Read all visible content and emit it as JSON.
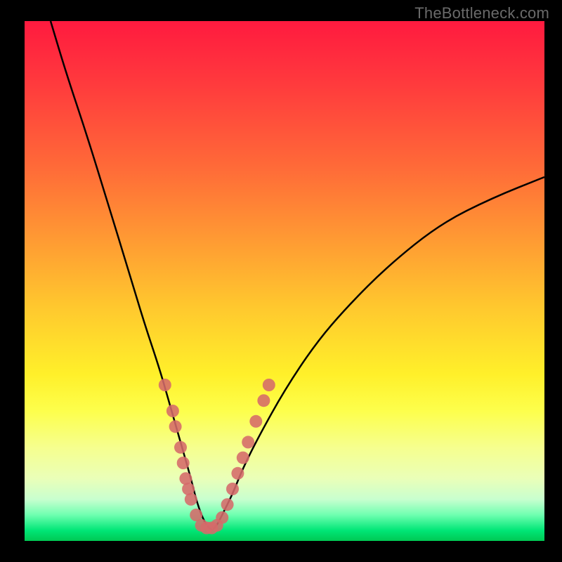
{
  "attribution": "TheBottleneck.com",
  "colors": {
    "frame": "#000000",
    "curve_stroke": "#000000",
    "marker_fill": "#d56a6a",
    "gradient_top": "#ff1a3f",
    "gradient_bottom": "#00c853"
  },
  "chart_data": {
    "type": "line",
    "title": "",
    "xlabel": "",
    "ylabel": "",
    "xlim": [
      0,
      100
    ],
    "ylim": [
      0,
      100
    ],
    "note": "Axes are not labeled in the image; values estimated from pixel positions. y=0 corresponds to the bottom (green) edge, y=100 to the top (red) edge.",
    "series": [
      {
        "name": "bottleneck-curve",
        "x": [
          5,
          8,
          12,
          16,
          20,
          23,
          26,
          28,
          30,
          32,
          33,
          34,
          35,
          36,
          37,
          38,
          40,
          42,
          45,
          50,
          56,
          62,
          70,
          80,
          90,
          100
        ],
        "y": [
          100,
          90,
          78,
          65,
          52,
          42,
          33,
          26,
          19,
          12,
          8,
          5,
          3,
          2,
          3,
          5,
          9,
          14,
          20,
          29,
          38,
          45,
          53,
          61,
          66,
          70
        ]
      }
    ],
    "markers": {
      "name": "highlighted-points",
      "note": "Pink circular markers clustered near the curve minimum on both branches",
      "points": [
        {
          "x": 27,
          "y": 30
        },
        {
          "x": 28.5,
          "y": 25
        },
        {
          "x": 29,
          "y": 22
        },
        {
          "x": 30,
          "y": 18
        },
        {
          "x": 30.5,
          "y": 15
        },
        {
          "x": 31,
          "y": 12
        },
        {
          "x": 31.5,
          "y": 10
        },
        {
          "x": 32,
          "y": 8
        },
        {
          "x": 33,
          "y": 5
        },
        {
          "x": 34,
          "y": 3
        },
        {
          "x": 35,
          "y": 2.5
        },
        {
          "x": 36,
          "y": 2.5
        },
        {
          "x": 37,
          "y": 3
        },
        {
          "x": 38,
          "y": 4.5
        },
        {
          "x": 39,
          "y": 7
        },
        {
          "x": 40,
          "y": 10
        },
        {
          "x": 41,
          "y": 13
        },
        {
          "x": 42,
          "y": 16
        },
        {
          "x": 43,
          "y": 19
        },
        {
          "x": 44.5,
          "y": 23
        },
        {
          "x": 46,
          "y": 27
        },
        {
          "x": 47,
          "y": 30
        }
      ]
    }
  }
}
